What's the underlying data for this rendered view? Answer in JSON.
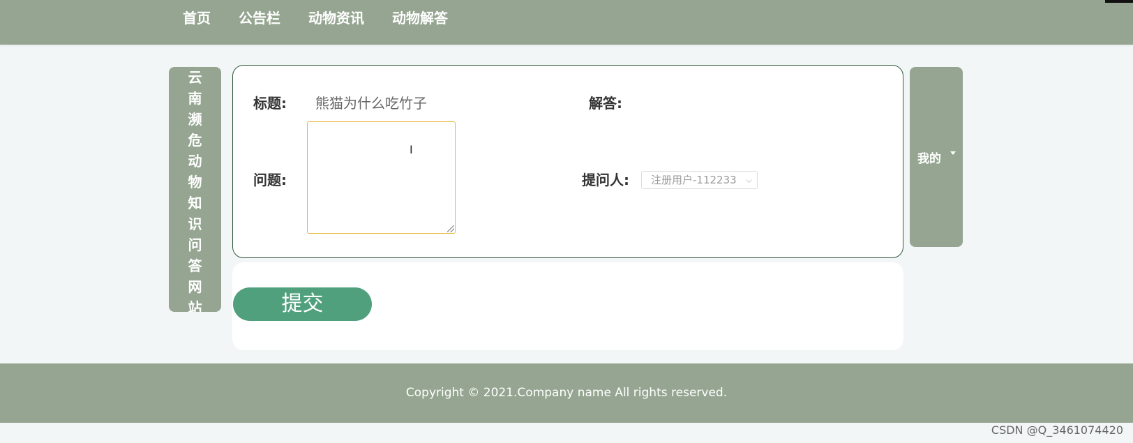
{
  "nav": {
    "items": [
      {
        "label": "首页"
      },
      {
        "label": "公告栏"
      },
      {
        "label": "动物资讯"
      },
      {
        "label": "动物解答"
      }
    ]
  },
  "side_title": {
    "chars": [
      "云",
      "南",
      "濒",
      "危",
      "动",
      "物",
      "知",
      "识",
      "问",
      "答",
      "网",
      "站"
    ]
  },
  "form": {
    "title_label": "标题:",
    "title_value": "熊猫为什么吃竹子",
    "question_label": "问题:",
    "question_value": "",
    "answer_label": "解答:",
    "asker_label": "提问人:",
    "asker_value": "注册用户-112233",
    "cursor_glyph": "I"
  },
  "actions": {
    "submit_label": "提交"
  },
  "user_menu": {
    "label": "我的"
  },
  "footer": {
    "copyright": "Copyright © 2021.Company name All rights reserved."
  },
  "watermark": "CSDN @Q_3461074420",
  "colors": {
    "header_bg": "#95a591",
    "submit_bg": "#50a07d",
    "card_border": "#2f5a3c",
    "question_border": "#e6b53c"
  },
  "icons": {
    "dropdown": "chevron-down-icon",
    "user_caret": "caret-down-icon",
    "text_cursor": "text-cursor-icon",
    "resize": "resize-grip-icon"
  }
}
